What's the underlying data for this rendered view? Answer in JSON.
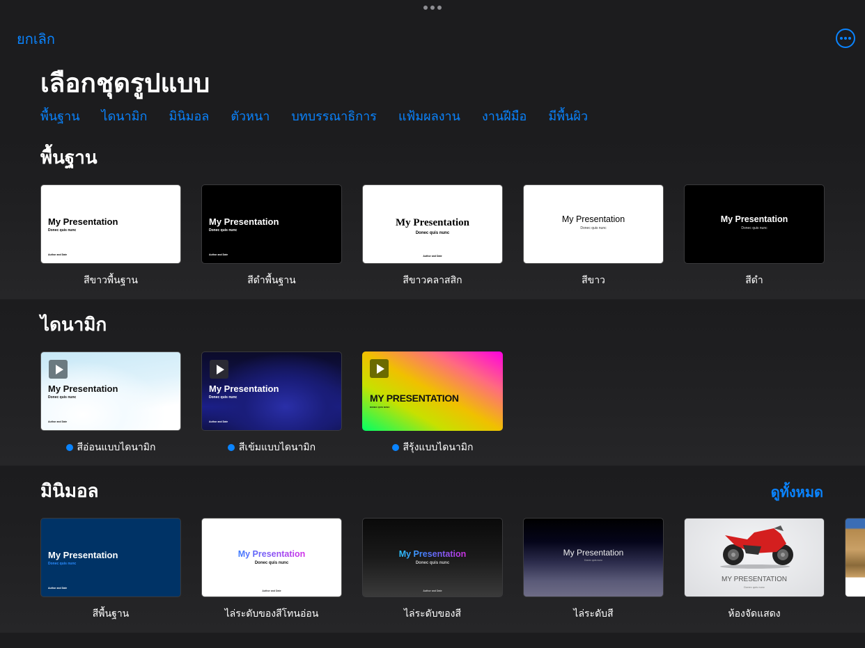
{
  "header": {
    "cancel_label": "ยกเลิก",
    "more_icon": "ellipsis-circle-icon",
    "title": "เลือกชุดรูปแบบ",
    "categories": [
      "พื้นฐาน",
      "ไดนามิก",
      "มินิมอล",
      "ตัวหนา",
      "บทบรรณาธิการ",
      "แฟ้มผลงาน",
      "งานฝีมือ",
      "มีพื้นผิว"
    ]
  },
  "sections": {
    "basic": {
      "heading": "พื้นฐาน",
      "themes": [
        {
          "name": "สีขาวพื้นฐาน",
          "title": "My Presentation",
          "subtitle": "Donec quis nunc",
          "author": "Author and Date"
        },
        {
          "name": "สีดำพื้นฐาน",
          "title": "My Presentation",
          "subtitle": "Donec quis nunc",
          "author": "Author and Date"
        },
        {
          "name": "สีขาวคลาสสิก",
          "title": "My Presentation",
          "subtitle": "Donec quis nunc",
          "author": "Author and Date"
        },
        {
          "name": "สีขาว",
          "title": "My Presentation",
          "subtitle": "Donec quis nunc"
        },
        {
          "name": "สีดำ",
          "title": "My Presentation",
          "subtitle": "Donec quis nunc"
        }
      ]
    },
    "dynamic": {
      "heading": "ไดนามิก",
      "themes": [
        {
          "name": "สีอ่อนแบบไดนามิก",
          "title": "My Presentation",
          "subtitle": "Donec quis nunc",
          "author": "Author and Date",
          "badge": "dynamic-dot"
        },
        {
          "name": "สีเข้มแบบไดนามิก",
          "title": "My Presentation",
          "subtitle": "Donec quis nunc",
          "author": "Author and Date",
          "badge": "dynamic-dot"
        },
        {
          "name": "สีรุ้งแบบไดนามิก",
          "title": "MY PRESENTATION",
          "subtitle": "DONEC QUIS NUNC",
          "badge": "dynamic-dot"
        }
      ]
    },
    "minimal": {
      "heading": "มินิมอล",
      "see_all_label": "ดูทั้งหมด",
      "themes": [
        {
          "name": "สีพื้นฐาน",
          "title": "My Presentation",
          "subtitle": "Donec quis nunc",
          "author": "Author and Date"
        },
        {
          "name": "ไล่ระดับของสีโทนอ่อน",
          "title": "My Presentation",
          "subtitle": "Donec quis nunc",
          "author": "Author and Date"
        },
        {
          "name": "ไล่ระดับของสี",
          "title": "My Presentation",
          "subtitle": "Donec quis nunc",
          "author": "Author and Date"
        },
        {
          "name": "ไล่ระดับสี",
          "title": "My Presentation",
          "subtitle": "Donec quis nunc"
        },
        {
          "name": "ห้องจัดแสดง",
          "title": "MY PRESENTATION",
          "subtitle": "Donec quis nunc"
        }
      ]
    }
  },
  "colors": {
    "accent": "#0a84ff",
    "background": "#1c1c1e"
  }
}
